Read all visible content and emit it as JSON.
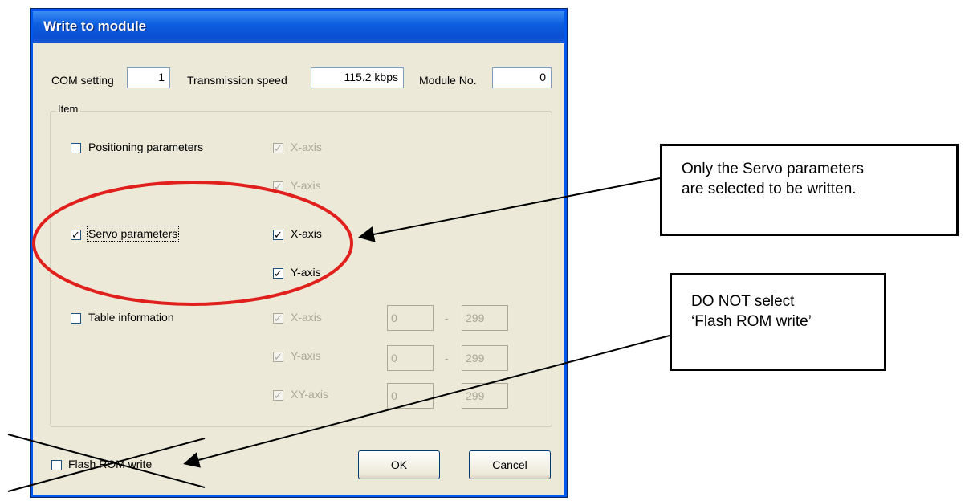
{
  "dialog": {
    "title": "Write to module",
    "com_setting_label": "COM setting",
    "com_setting_value": "1",
    "speed_label": "Transmission speed",
    "speed_value": "115.2 kbps",
    "module_label": "Module No.",
    "module_value": "0",
    "group_label": "Item",
    "positioning": {
      "label": "Positioning parameters",
      "checked": false,
      "x_label": "X-axis",
      "y_label": "Y-axis"
    },
    "servo": {
      "label": "Servo parameters",
      "checked": true,
      "x_label": "X-axis",
      "y_label": "Y-axis"
    },
    "table": {
      "label": "Table information",
      "checked": false,
      "x_label": "X-axis",
      "y_label": "Y-axis",
      "xy_label": "XY-axis",
      "x_from": "0",
      "x_to": "299",
      "y_from": "0",
      "y_to": "299",
      "xy_from": "0",
      "xy_to": "299",
      "dash": "-"
    },
    "flash_label": "Flash ROM write",
    "ok_label": "OK",
    "cancel_label": "Cancel"
  },
  "annotations": {
    "callout1_line1": "Only the Servo parameters",
    "callout1_line2": "are selected to be written.",
    "callout2_line1": "DO NOT select",
    "callout2_line2": "‘Flash ROM write’",
    "highlight_color": "#e0201c"
  }
}
